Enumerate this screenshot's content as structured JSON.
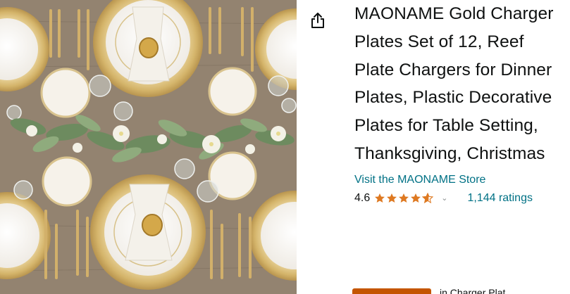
{
  "product": {
    "title": "MAONAME Gold Charger Plates Set of 12, Reef Plate Chargers for Dinner Plates, Plastic Decorative Plates for Table Setting, Thanksgiving, Christmas",
    "store_link": "Visit the MAONAME Store",
    "rating_value": "4.6",
    "rating_out_of_5": 4.6,
    "ratings_count": "1,144 ratings",
    "cut_off_text": "in Charger Plat"
  },
  "icons": {
    "share": "share-icon",
    "star": "star-icon",
    "chevron": "chevron-down-icon"
  },
  "colors": {
    "title": "#0f1111",
    "link": "#007185",
    "star": "#de7921",
    "badge": "#c45500"
  }
}
